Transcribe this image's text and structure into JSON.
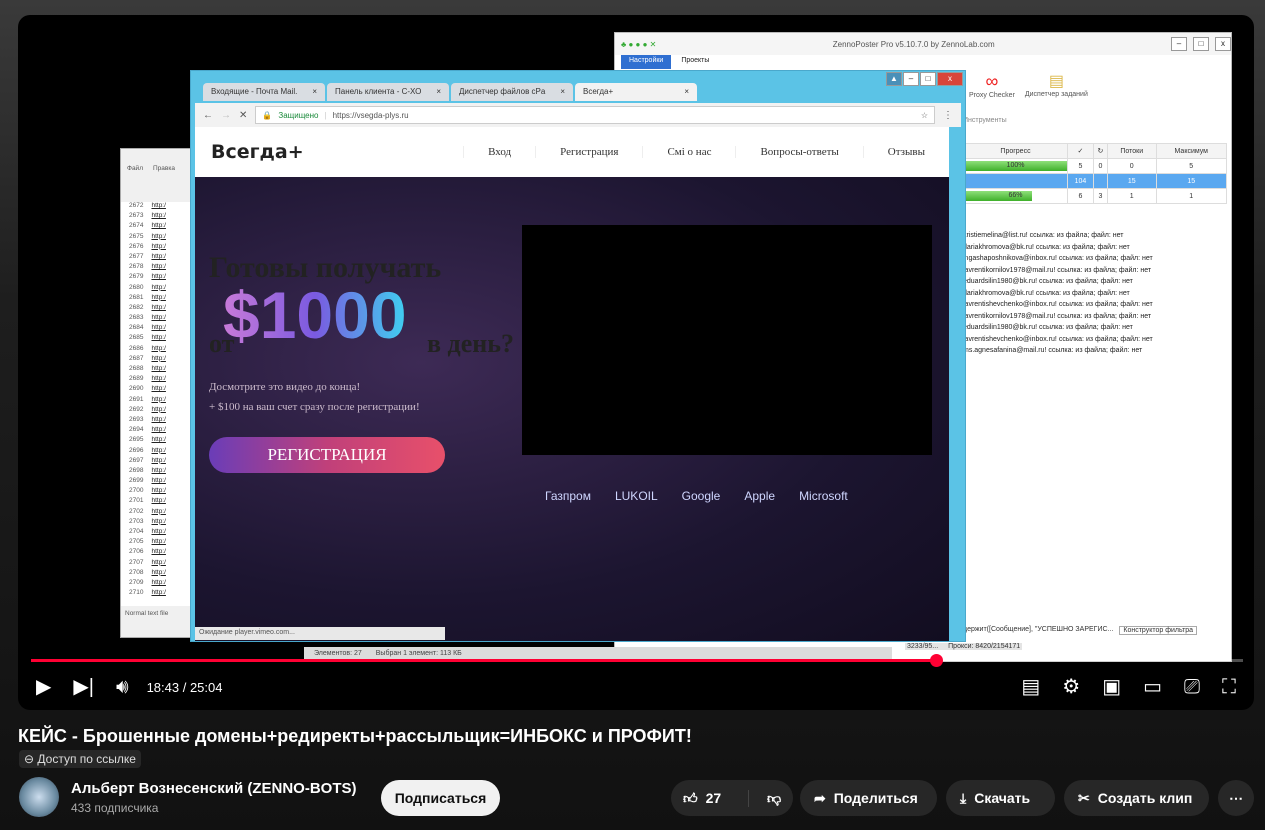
{
  "video": {
    "zennoposter": {
      "title": "ZennoPoster Pro v5.10.7.0 by ZennoLab.com",
      "tabs": [
        "Настройки",
        "Проекты"
      ],
      "tools": [
        "Proxy Checker",
        "Диспетчер заданий"
      ],
      "tools_group": "Инструменты",
      "table": {
        "headers": [
          "Прогресс",
          "✓",
          "↻",
          "Потоки",
          "Максимум"
        ],
        "rows": [
          {
            "progress": "100%",
            "pct": 100,
            "ok": "5",
            "retry": "0",
            "threads": "0",
            "max": "5"
          },
          {
            "progress": "",
            "pct": 0,
            "ok": "104",
            "retry": "",
            "threads": "15",
            "max": "15"
          },
          {
            "progress": "66%",
            "pct": 66,
            "ok": "6",
            "retry": "3",
            "threads": "1",
            "max": "1"
          }
        ]
      },
      "log": [
        "kristiemelina@list.ru! ссылка: из файла; файл: нет",
        "dariakhromova@bk.ru! ссылка: из файла; файл: нет",
        "ingashaposhnikova@inbox.ru! ссылка: из файла; файл: нет",
        "lavrentikornilov1978@mail.ru! ссылка: из файла; файл: нет",
        "eduardsilin1980@bk.ru! ссылка: из файла; файл: нет",
        "dariakhromova@bk.ru! ссылка: из файла; файл: нет",
        "lavrentishevchenko@inbox.ru! ссылка: из файла; файл: нет",
        "lavrentikornilov1978@mail.ru! ссылка: из файла; файл: нет",
        "eduardsilin1980@bk.ru! ссылка: из файла; файл: нет",
        "lavrentishevchenko@inbox.ru! ссылка: из файла; файл: нет",
        "ms.agnesafanina@mail.ru! ссылка: из файла; файл: нет"
      ],
      "filter_text": "держит([Сообщение], \"УСПЕШНО ЗАРЕГИС...",
      "filter_button": "Конструктор фильтра",
      "proxy_status": "Прокси: 8420/2154171",
      "counter": "3233/95..."
    },
    "browser": {
      "tabs": [
        "Входящие - Почта Mail.",
        "Панель клиента - С-ХО",
        "Диспетчер файлов cPa",
        "Всегда+"
      ],
      "secure_label": "Защищено",
      "url": "https://vsegda-plys.ru",
      "status": "Ожидание player.vimeo.com...",
      "site": {
        "logo": "Всегда+",
        "nav": [
          "Вход",
          "Регистрация",
          "Смi о нас",
          "Вопросы-ответы",
          "Отзывы"
        ],
        "headline_1": "Готовы получать",
        "headline_from": "от",
        "headline_amount": "$1000",
        "headline_end": "в день?",
        "sub_1": "Досмотрите это видео до конца!",
        "sub_2": "+ $100 на ваш счет сразу после регистрации!",
        "cta": "РЕГИСТРАЦИЯ",
        "brands": [
          "Газпром",
          "LUKOIL",
          "Google",
          "Apple",
          "Microsoft"
        ]
      }
    },
    "notepad": {
      "menu": [
        "Файл",
        "Правка"
      ],
      "line_start": 2672,
      "line_count": 39,
      "line_text": "http:/",
      "status": "Normal text file"
    },
    "explorer_status": {
      "elements": "Элементов: 27",
      "selected": "Выбран 1 элемент: 113 КБ"
    }
  },
  "player": {
    "current_time": "18:43",
    "duration": "25:04",
    "time_display": "18:43 / 25:04",
    "progress_fraction": 0.747
  },
  "title": "КЕЙС - Брошенные домены+редиректы+рассыльщик=ИНБОКС и ПРОФИТ!",
  "visibility": "Доступ по ссылке",
  "channel": {
    "name": "Альберт Вознесенский (ZENNO-BOTS)",
    "subscribers": "433 подписчика",
    "subscribe": "Подписаться"
  },
  "actions": {
    "likes": "27",
    "share": "Поделиться",
    "download": "Скачать",
    "clip": "Создать клип"
  },
  "colors": {
    "accent": "#ff0033",
    "bg": "#0f0f0f"
  }
}
